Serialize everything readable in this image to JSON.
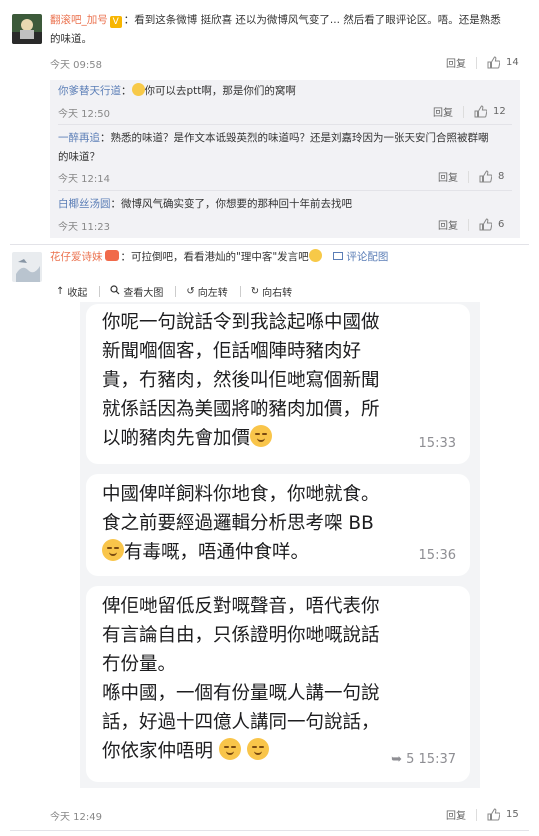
{
  "comment1": {
    "username": "翻滚吧_加号",
    "text": "：看到这条微博 挺欣喜 还以为微博风气变了... 然后看了眼评论区。唔。还是熟悉",
    "text2": "的味道。",
    "time": "今天 09:58",
    "reply_label": "回复",
    "likes": "14"
  },
  "replies": [
    {
      "username": "你爹替天行道",
      "text": "你可以去ptt啊，那是你们的窝啊",
      "time": "今天 12:50",
      "reply_label": "回复",
      "likes": "12"
    },
    {
      "username": "一醉再追",
      "text": "：熟悉的味道？是作文本诋毁英烈的味道吗？还是刘嘉玲因为一张天安门合照被群嘲",
      "text2": "的味道？",
      "time": "今天 12:14",
      "reply_label": "回复",
      "likes": "8"
    },
    {
      "username": "白椰丝汤圆",
      "text": "：微博风气确实变了，你想要的那种回十年前去找吧",
      "time": "今天 11:23",
      "reply_label": "回复",
      "likes": "6"
    }
  ],
  "comment2": {
    "username": "花仔爱诗妹",
    "text": "：可拉倒吧，看看港灿的\"理中客\"发言吧",
    "pic_link": "评论配图",
    "time": "今天 12:49",
    "reply_label": "回复",
    "likes": "15"
  },
  "image_toolbar": {
    "collapse": "收起",
    "view_large": "查看大图",
    "rotate_left": "向左转",
    "rotate_right": "向右转"
  },
  "chat": {
    "bubble1_lines": [
      "你呢一句說話令到我諗起喺中國做",
      "新聞嗰個客，佢話嗰陣時豬肉好",
      "貴，冇豬肉，然後叫佢哋寫個新聞",
      "就係話因為美國將啲豬肉加價，所",
      "以啲豬肉先會加價"
    ],
    "bubble1_time": "15:33",
    "bubble2_lines": [
      "中國俾咩飼料你地食，你哋就食。",
      "食之前要經過邏輯分析思考㗎 BB"
    ],
    "bubble2_line3": "有毒嘅，唔通仲食咩。",
    "bubble2_time": "15:36",
    "bubble3_lines": [
      "俾佢哋留低反對嘅聲音，唔代表你",
      "有言論自由，只係證明你哋嘅說話",
      "冇份量。",
      "喺中國，一個有份量嘅人講一句說",
      "話，好過十四億人講同一句說話，"
    ],
    "bubble3_last": "你依家仲唔明",
    "bubble3_fwd": "5",
    "bubble3_time": "15:37"
  },
  "colors": {
    "link": "#eb7350",
    "username": "#5a7db6",
    "replies_bg": "#f2f2f5",
    "chat_bg": "#f3f4f6"
  }
}
